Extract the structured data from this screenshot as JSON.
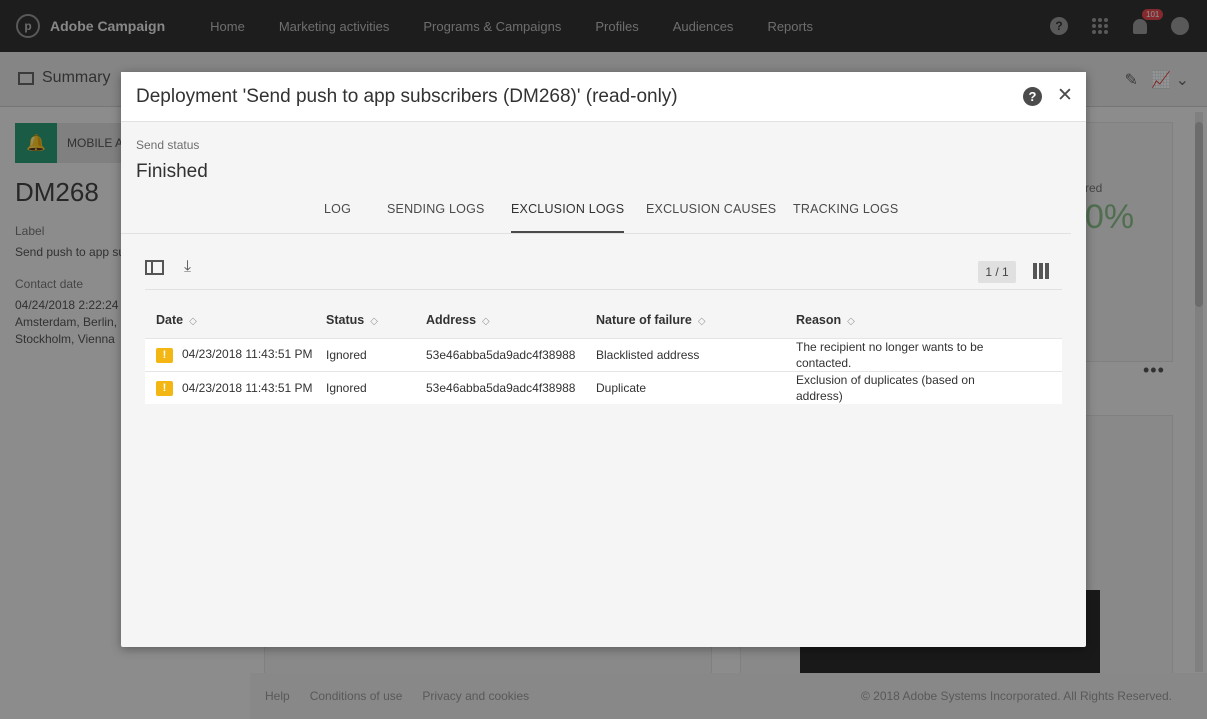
{
  "app": {
    "name": "Adobe Campaign",
    "logo_glyph": "p"
  },
  "nav": [
    "Home",
    "Marketing activities",
    "Programs & Campaigns",
    "Profiles",
    "Audiences",
    "Reports"
  ],
  "topbar": {
    "notification_count": "101",
    "help_glyph": "?"
  },
  "background": {
    "page_title": "Summary",
    "channel_tag": "MOBILE A",
    "delivery_id": "DM268",
    "label_heading": "Label",
    "label_value": "Send push to app su",
    "contact_heading": "Contact date",
    "contact_value_1": "04/24/2018 2:22:24 P",
    "contact_value_2": "Amsterdam, Berlin, I",
    "contact_value_3": "Stockholm, Vienna",
    "metric_label": "red",
    "metric_value": "0%",
    "footer_links": [
      "Help",
      "Conditions of use",
      "Privacy and cookies"
    ],
    "copyright": "© 2018 Adobe Systems Incorporated. All Rights Reserved."
  },
  "modal": {
    "title": "Deployment 'Send push to app subscribers (DM268)' (read-only)",
    "help_glyph": "?",
    "close_glyph": "✕",
    "send_status_label": "Send status",
    "send_status_value": "Finished",
    "tabs": [
      "LOG",
      "SENDING LOGS",
      "EXCLUSION LOGS",
      "EXCLUSION CAUSES",
      "TRACKING LOGS"
    ],
    "active_tab": "EXCLUSION LOGS",
    "pager": "1 / 1",
    "table": {
      "columns": [
        "Date",
        "Status",
        "Address",
        "Nature of failure",
        "Reason"
      ],
      "rows": [
        {
          "date": "04/23/2018 11:43:51 PM",
          "status": "Ignored",
          "address": "53e46abba5da9adc4f38988",
          "nature": "Blacklisted address",
          "reason": "The recipient no longer wants to be contacted."
        },
        {
          "date": "04/23/2018 11:43:51 PM",
          "status": "Ignored",
          "address": "53e46abba5da9adc4f38988",
          "nature": "Duplicate",
          "reason": "Exclusion of duplicates (based on address)"
        }
      ]
    }
  },
  "icons": {
    "warning": "warning-icon",
    "download": "download-icon",
    "panel": "panel-toggle-icon",
    "columns": "columns-settings-icon"
  },
  "colors": {
    "topbar": "#323232",
    "warning": "#f3b612",
    "badge": "#e34850",
    "channel": "#2d9d78"
  }
}
